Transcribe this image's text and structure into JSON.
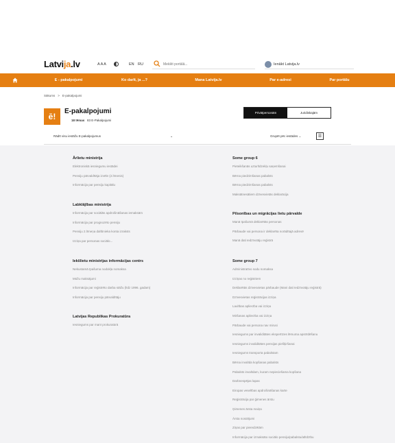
{
  "header": {
    "logo_main": "Latvi",
    "logo_accent": "ja",
    "logo_tail": ".lv",
    "font_size_label": "A A A",
    "lang_en": "EN",
    "lang_ru": "RU",
    "search_placeholder": "Meklēt portālā...",
    "login_label": "Ienākt Latvija.lv"
  },
  "nav": {
    "items": [
      "E - pakalpojumi",
      "Ko darīt, ja ...?",
      "Mana Latvija.lv",
      "Par e-adresi",
      "Par portālu"
    ]
  },
  "breadcrumb": {
    "home": "Sākums",
    "separator": ">",
    "current": "E-pakalpojumi"
  },
  "page": {
    "icon_text": "ē!",
    "title": "E-pakalpojumi",
    "themes_count": "18 tēmas",
    "services_count": "83 E-Pakalpojumi"
  },
  "toggle": {
    "active": "Privātpersonām",
    "inactive": "Juridiskajām"
  },
  "filter": {
    "label": "Rādīt visu iestāžu E-pakalpojumus",
    "caret": "⌄",
    "group_label": "Grupēt pēc iestādes",
    "group_caret": "⌄",
    "group_icon": "☰"
  },
  "groups_left": [
    {
      "title": "Ārlietu ministrija",
      "links": [
        "Elektroniskā iesniegumu iestādei",
        "Pensiju pārvaldītāja izvēle (2.līmenis)",
        "Informācija par pensiju kapitālu"
      ]
    },
    {
      "title": "Labklājības ministrija",
      "links": [
        "Informācija par sociālās apdrošināšanas iemaksām",
        "Informācija par prognozēto pensiju",
        "Pensiju 2.līmeņa dalībnieka konta izraksts",
        "Izziņa par personas sociālo..."
      ]
    },
    {
      "title": "Iekšlietu ministrijas informācijas centrs",
      "links": [
        "Nekustamā īpašuma nodokļa nomaksa",
        "Mūžu maksājumi",
        "Informācija par reģistrēto darba stāžu (līdz 1996. gadam)",
        "Informācija par pensiju pārvaldītāju"
      ]
    },
    {
      "title": "Latvijas Republikas Prokuratūra",
      "links": [
        "Iesniegums par manī prokuratūrā"
      ]
    }
  ],
  "groups_right": [
    {
      "title": "Some group 6",
      "links": [
        "Pieteikšanās uzturlīdzekļu saņemšanai",
        "Bērna piedzimšanas pabalsts",
        "Bērna piedzimšanas pabalsts",
        "Maksātnesātiem dzīvesvietās deklarācija"
      ]
    },
    {
      "title": "Pilsonības un migrācijas lietu pārvalde",
      "links": [
        "Manā īpašumā deklarētās personas",
        "Pārbaude vai persona ir deklarēta norādītajā adresē",
        "Manā dati Iedzīvotāju reģistrā"
      ]
    },
    {
      "title": "Some group 7",
      "links": [
        "Administratīvo sodu nomaksa",
        "Izziņas no reģistriem",
        "Deklarētās dzīvesvietas pārbaude (Mani dati Iedzīvotāju reģistrā)",
        "Dzīvesvietas reģistrācijas izziņa",
        "Laulības apliecība vai izziņa",
        "Miršanas apliecība vai izziņa",
        "Pārbaude vai persona nav mirusi",
        "Iesniegums par invaliditātes ekspertīzes lēmuma apstrīdēšanu",
        "Iesniegums invaliditātes pensijas piešķiršanai",
        "Iesniegums transporta pabalstam",
        "Bērna invalīda kopšanas pabalsts",
        "Pabalsts invalīdam, kuram nepieciešama kopšana",
        "Darbnespējas lapas",
        "Eiropas veselības apdrošināšanas karte",
        "Reģistrācija par ģimenes ārstu",
        "Ģimenes ārsta maiņa",
        "Ārsta nosūtījumi",
        "Ziņas par pieredzētām",
        "Informācija par izmaksāto sociālo pensiju/pabalstu/atlīdzību"
      ]
    }
  ],
  "colors": {
    "nav_orange": "#e57f12",
    "content_bg": "#f3f3f5"
  }
}
